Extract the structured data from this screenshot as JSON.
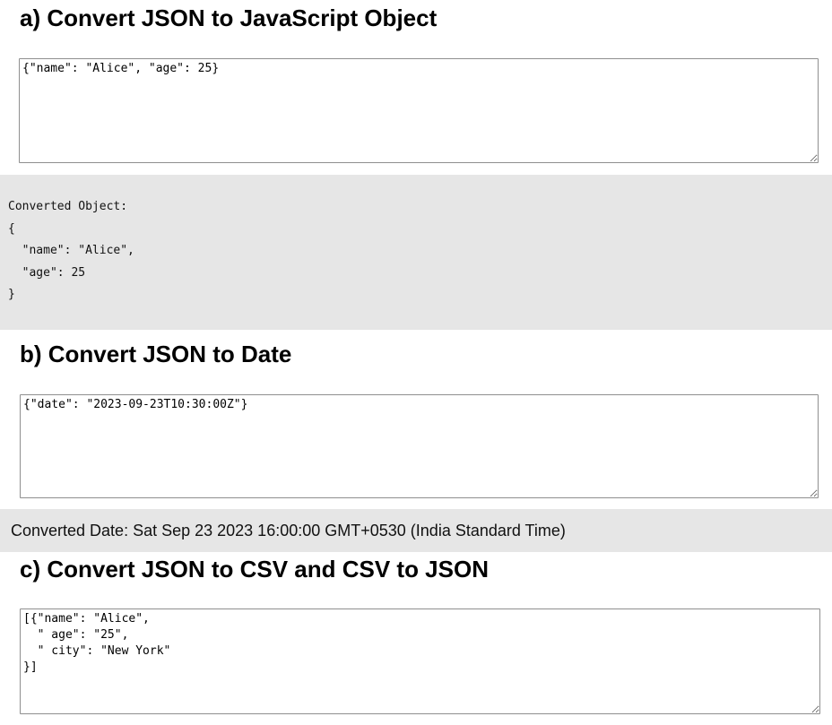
{
  "section_a": {
    "heading": "a) Convert JSON to JavaScript Object",
    "input_value": "{\"name\": \"Alice\", \"age\": 25}",
    "output_label": "Converted Object:",
    "output_body": "{\n  \"name\": \"Alice\",\n  \"age\": 25\n}"
  },
  "section_b": {
    "heading": "b) Convert JSON to Date",
    "input_value": "{\"date\": \"2023-09-23T10:30:00Z\"}",
    "output_text": "Converted Date: Sat Sep 23 2023 16:00:00 GMT+0530 (India Standard Time)"
  },
  "section_c": {
    "heading": "c) Convert JSON to CSV and CSV to JSON",
    "input_value": "[{\"name\": \"Alice\",\n  \" age\": \"25\",\n  \" city\": \"New York\"\n}]"
  },
  "colors": {
    "output_background": "#e6e6e6",
    "textarea_border": "#8f8f8f"
  }
}
